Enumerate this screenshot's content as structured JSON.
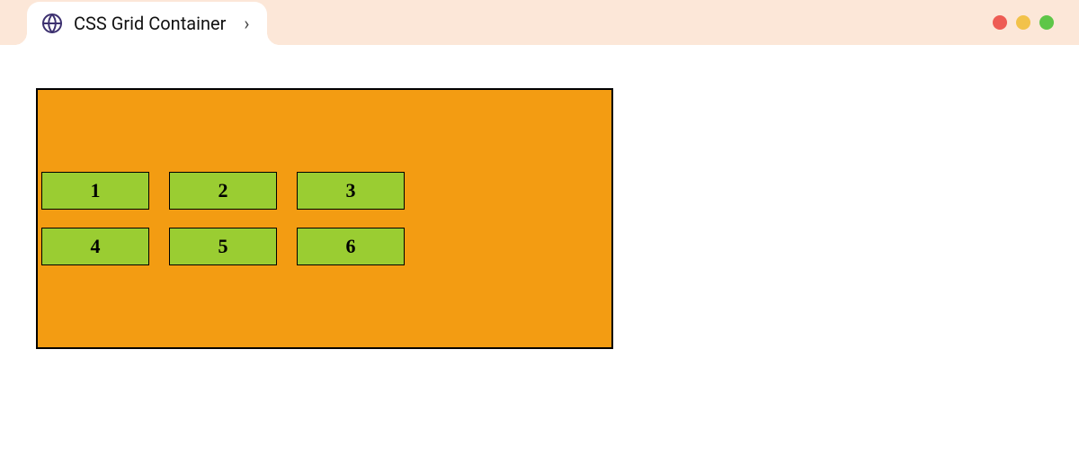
{
  "tab": {
    "title": "CSS Grid Container"
  },
  "grid": {
    "items": [
      "1",
      "2",
      "3",
      "4",
      "5",
      "6"
    ]
  }
}
